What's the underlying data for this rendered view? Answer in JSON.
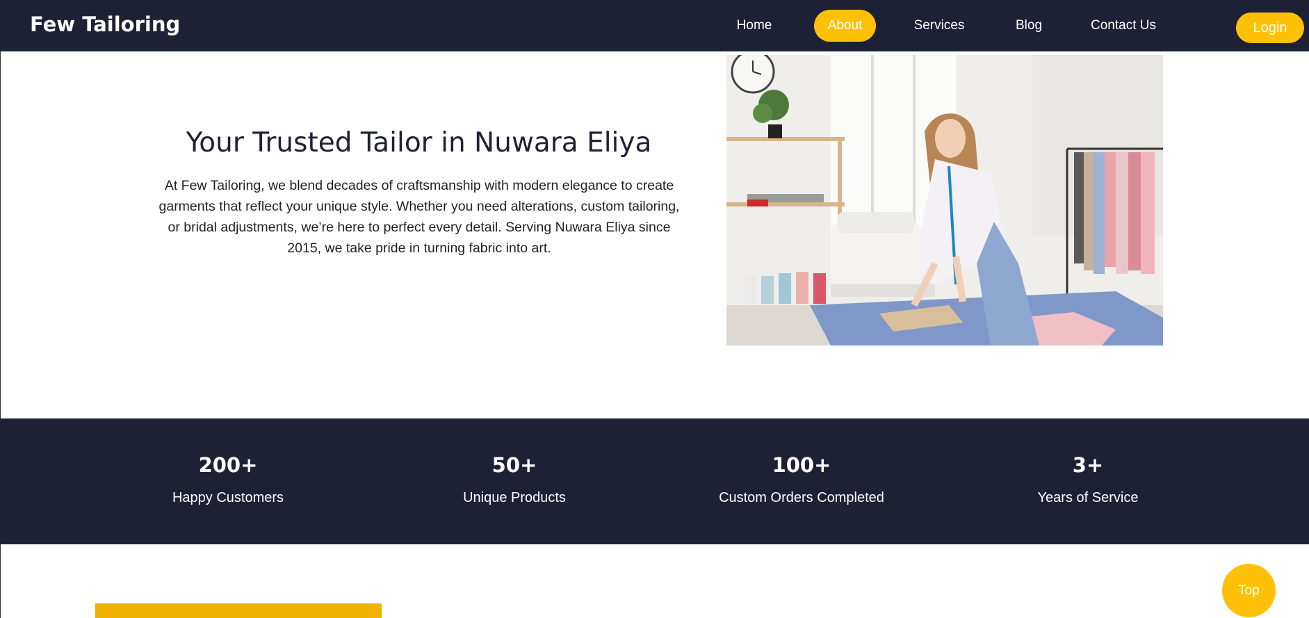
{
  "header": {
    "brand": "Few Tailoring",
    "nav": [
      {
        "label": "Home"
      },
      {
        "label": "About"
      },
      {
        "label": "Services"
      },
      {
        "label": "Blog"
      },
      {
        "label": "Contact Us"
      }
    ],
    "active_nav": "About",
    "login_label": "Login"
  },
  "hero": {
    "title": "Your Trusted Tailor in Nuwara Eliya",
    "text": "At Few Tailoring, we blend decades of craftsmanship with modern elegance to create garments that reflect your unique style. Whether you need alterations, custom tailoring, or bridal adjustments, we’re here to perfect every detail. Serving Nuwara Eliya since 2015, we take pride in turning fabric into art."
  },
  "stats": [
    {
      "number": "200+",
      "label": "Happy Customers"
    },
    {
      "number": "50+",
      "label": "Unique Products"
    },
    {
      "number": "100+",
      "label": "Custom Orders Completed"
    },
    {
      "number": "3+",
      "label": "Years of Service"
    }
  ],
  "top_button_label": "Top",
  "colors": {
    "navy": "#1e2136",
    "accent": "#ffc107"
  }
}
